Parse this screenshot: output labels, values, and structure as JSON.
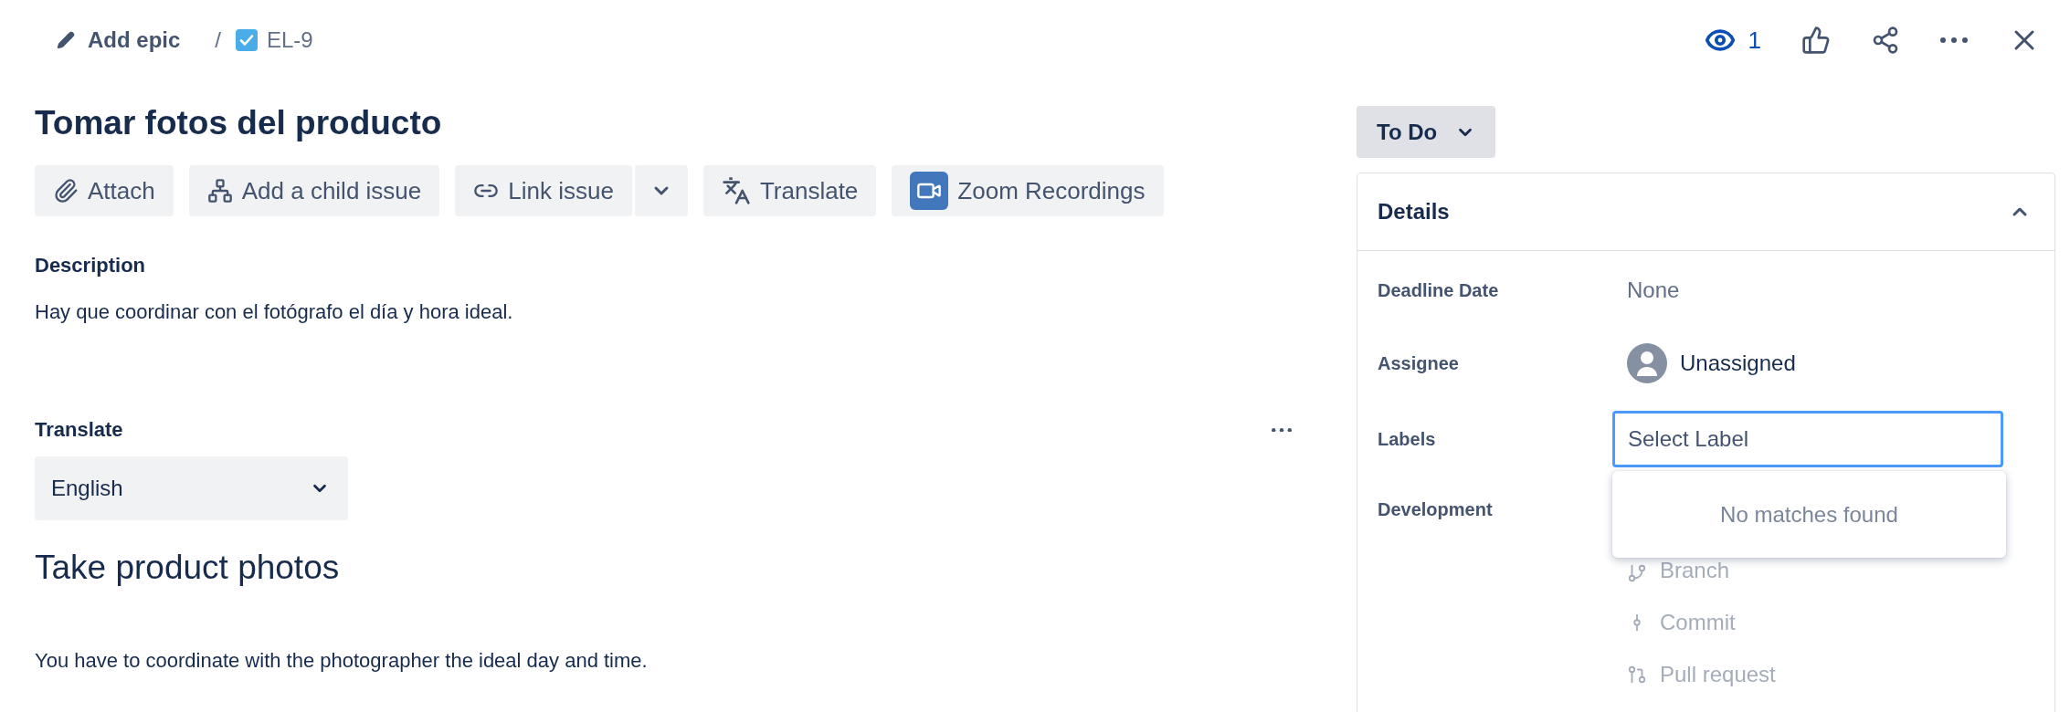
{
  "breadcrumb": {
    "epic": "Add epic",
    "separator": "/",
    "issue_key": "EL-9",
    "issue_done": true
  },
  "header_actions": {
    "watchers": "1",
    "watching": true
  },
  "title": "Tomar fotos del producto",
  "toolbar": [
    {
      "kind": "attach",
      "label": "Attach",
      "split": false
    },
    {
      "kind": "child",
      "label": "Add a child issue",
      "split": false
    },
    {
      "kind": "link",
      "label": "Link issue",
      "split": true
    },
    {
      "kind": "translate",
      "label": "Translate",
      "split": false
    },
    {
      "kind": "zoom",
      "label": "Zoom Recordings",
      "split": false
    }
  ],
  "description": {
    "label": "Description",
    "text": "Hay que coordinar con el fotógrafo el día y hora ideal."
  },
  "translate": {
    "label": "Translate",
    "language": "English",
    "heading": "Take product photos",
    "text": "You have to coordinate with the photographer the ideal day and time."
  },
  "status": {
    "label": "To Do"
  },
  "details": {
    "title": "Details",
    "expanded": true,
    "fields": [
      {
        "kind": "text",
        "label": "Deadline Date",
        "value": "None"
      },
      {
        "kind": "user",
        "label": "Assignee",
        "value": "Unassigned"
      },
      {
        "kind": "select",
        "label": "Labels",
        "placeholder": "Select Label",
        "focused": true
      },
      {
        "kind": "dev",
        "label": "Development",
        "items": [
          {
            "kind": "branch",
            "label": "Branch"
          },
          {
            "kind": "commit",
            "label": "Commit"
          },
          {
            "kind": "pull",
            "label": "Pull request"
          }
        ]
      }
    ]
  },
  "dropdown": {
    "message": "No matches found"
  }
}
